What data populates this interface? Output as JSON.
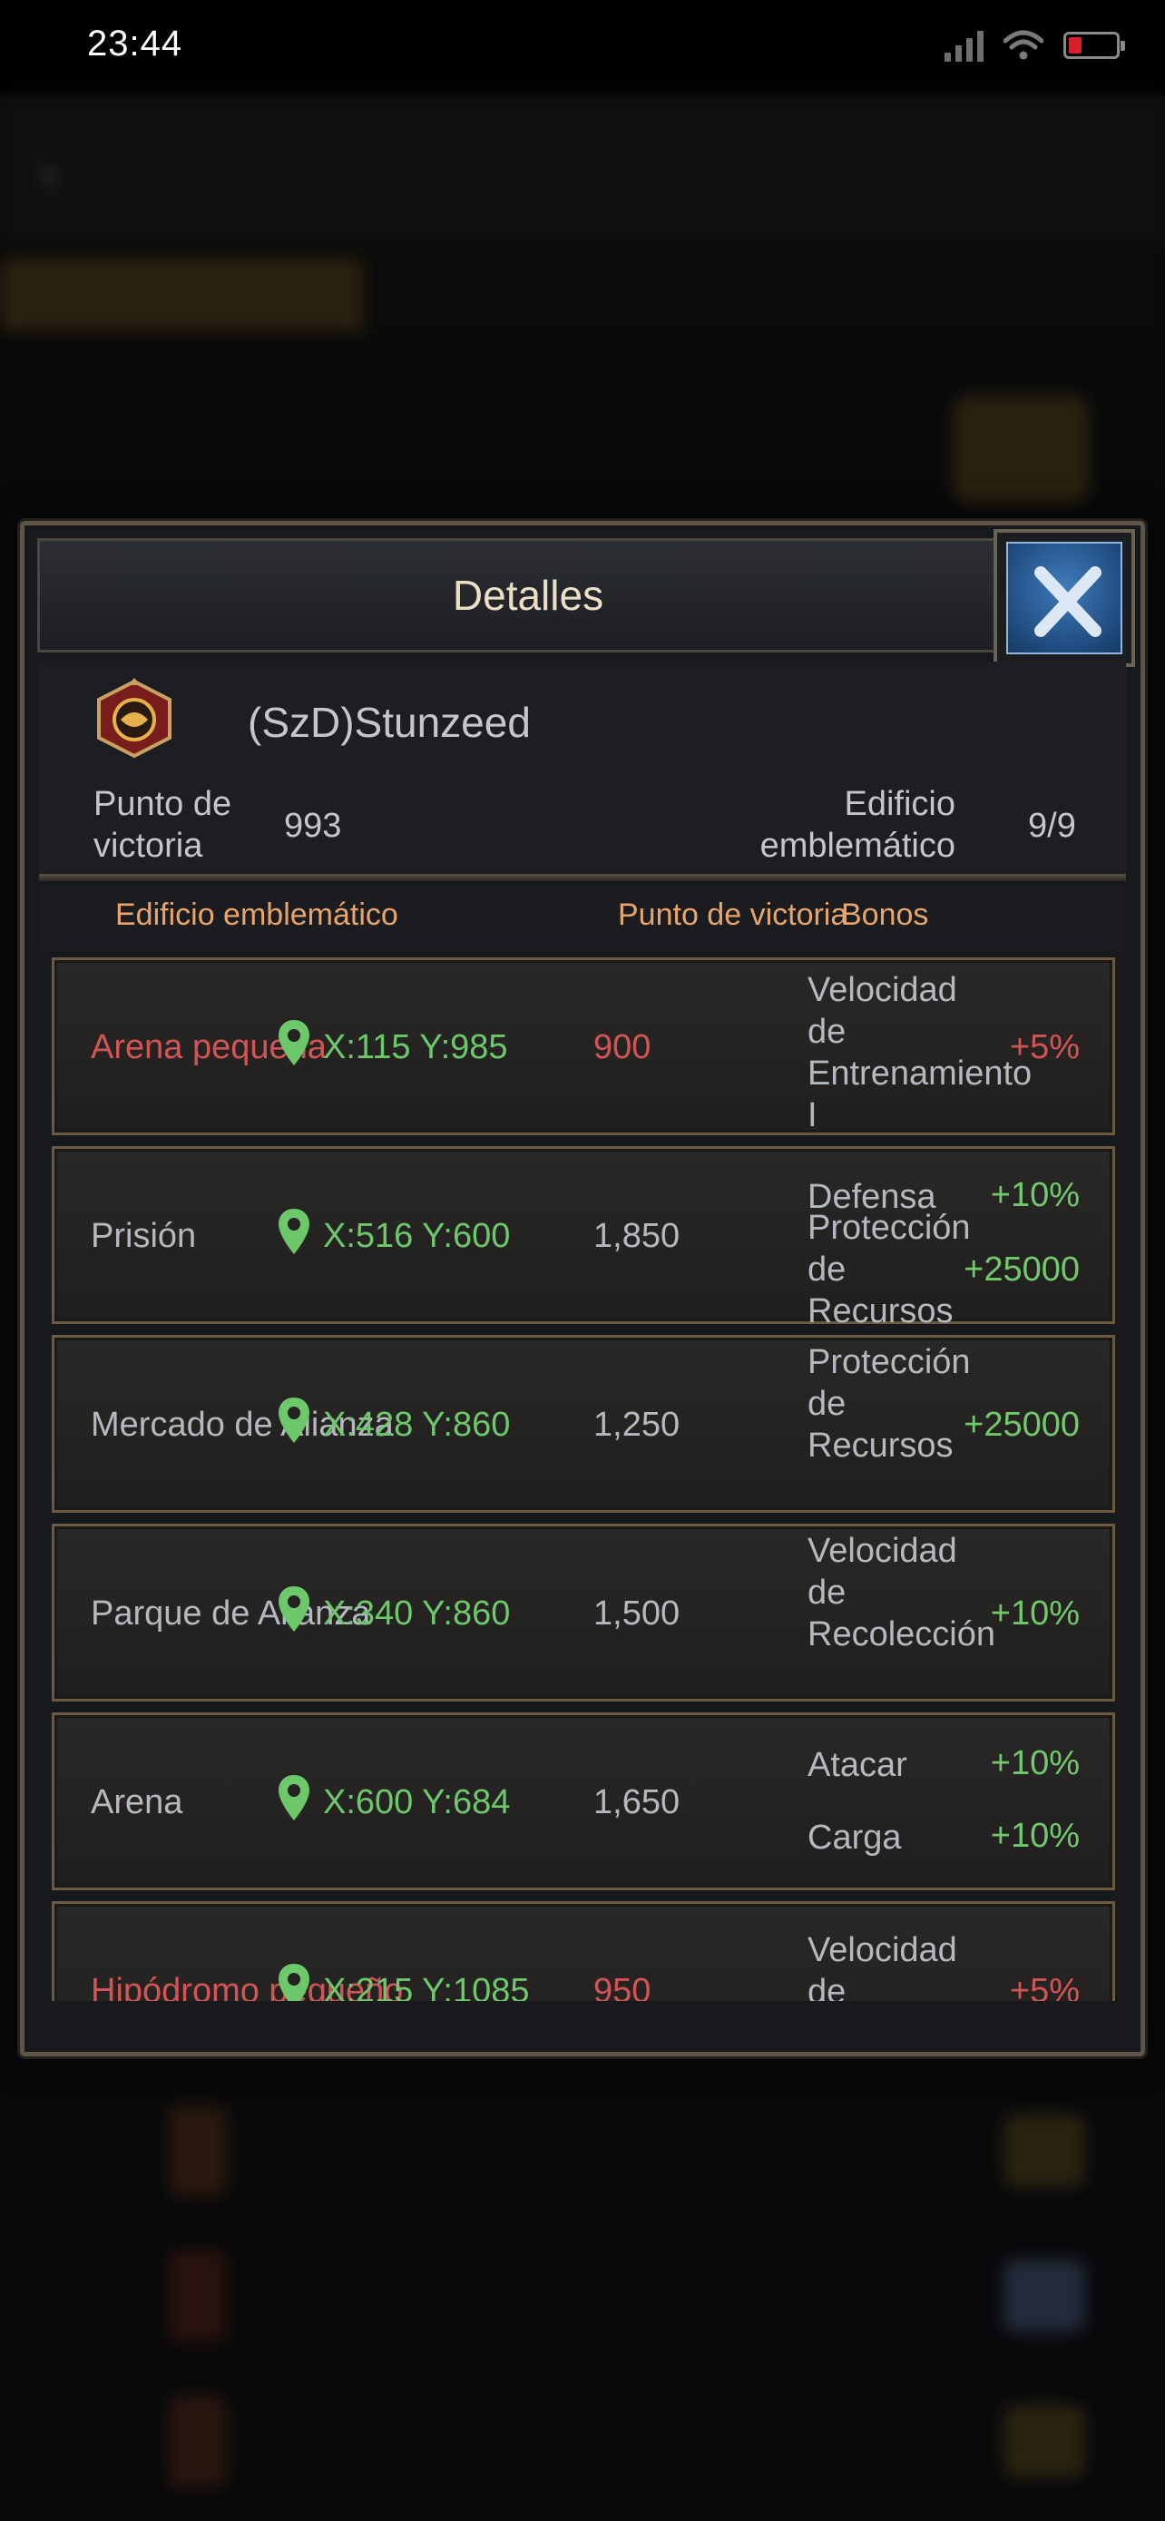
{
  "status_bar": {
    "time": "23:44"
  },
  "modal": {
    "title": "Detalles",
    "player_name": "(SzD)Stunzeed",
    "victory_points_label": "Punto de victoria",
    "victory_points_value": "993",
    "emblematic_label": "Edificio emblemático",
    "emblematic_value": "9/9",
    "columns": [
      "Edificio emblemático",
      "Punto de victoria",
      "Bonos"
    ],
    "rows": [
      {
        "name": "Arena pequeña",
        "coords": "X:115 Y:985",
        "points": "900",
        "owned": false,
        "bonuses": [
          {
            "text": "Velocidad de Entrenamiento I",
            "value": "+5%"
          }
        ]
      },
      {
        "name": "Prisión",
        "coords": "X:516 Y:600",
        "points": "1,850",
        "owned": true,
        "bonuses": [
          {
            "text": "Defensa",
            "value": "+10%"
          },
          {
            "text": "Protección de Recursos",
            "value": "+25000"
          }
        ]
      },
      {
        "name": "Mercado de Alianza",
        "coords": "X:428 Y:860",
        "points": "1,250",
        "owned": true,
        "bonuses": [
          {
            "text": "Protección de Recursos",
            "value": "+25000"
          }
        ]
      },
      {
        "name": "Parque de Alianza",
        "coords": "X:340 Y:860",
        "points": "1,500",
        "owned": true,
        "bonuses": [
          {
            "text": "Velocidad de Recolección",
            "value": "+10%"
          }
        ]
      },
      {
        "name": "Arena",
        "coords": "X:600 Y:684",
        "points": "1,650",
        "owned": true,
        "bonuses": [
          {
            "text": "Atacar",
            "value": "+10%"
          },
          {
            "text": "Carga",
            "value": "+10%"
          }
        ]
      },
      {
        "name": "Hipódromo pequeño",
        "coords": "X:215 Y:1085",
        "points": "950",
        "owned": false,
        "bonuses": [
          {
            "text": "Velocidad de",
            "value": "+5%"
          }
        ]
      }
    ]
  },
  "colors": {
    "header_text": "#e8a46a",
    "red": "#d25555",
    "green": "#72c86c",
    "gray": "#b4b8bf"
  }
}
